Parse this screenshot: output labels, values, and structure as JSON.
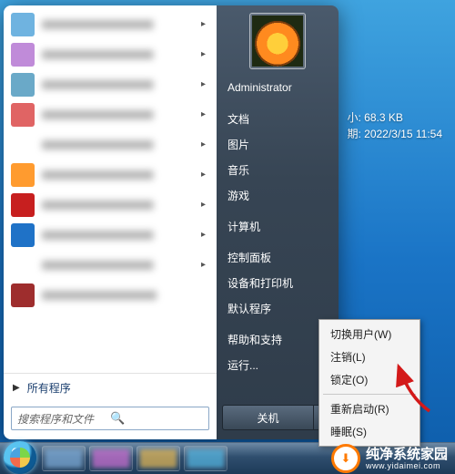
{
  "file_tip": {
    "size_label": "小:",
    "size_value": "68.3 KB",
    "date_label": "期:",
    "date_value": "2022/3/15 11:54"
  },
  "start_menu": {
    "pinned": [
      {
        "iconColor": "#6fb3e0"
      },
      {
        "iconColor": "#c08bd9"
      },
      {
        "iconColor": "#6aa9c8"
      },
      {
        "iconColor": "#e06464"
      },
      {
        "iconColor": "#ffffff"
      },
      {
        "iconColor": "#ff9b2f"
      },
      {
        "iconColor": "#c71f1f"
      },
      {
        "iconColor": "#1f72c7"
      },
      {
        "iconColor": "#ffffff"
      },
      {
        "iconColor": "#9e2d2d"
      }
    ],
    "all_programs": "所有程序",
    "search_placeholder": "搜索程序和文件",
    "right": {
      "username": "Administrator",
      "items": [
        "文档",
        "图片",
        "音乐",
        "游戏",
        "计算机",
        "控制面板",
        "设备和打印机",
        "默认程序",
        "帮助和支持",
        "运行..."
      ],
      "shutdown_label": "关机"
    }
  },
  "power_menu": {
    "items_top": [
      "切换用户(W)",
      "注销(L)",
      "锁定(O)"
    ],
    "items_bottom": [
      "重新启动(R)",
      "睡眠(S)"
    ]
  },
  "watermark": {
    "title": "纯净系统家园",
    "url": "www.yidaimei.com",
    "badge": "⬇"
  },
  "colors": {
    "accent": "#2a7bc7"
  }
}
